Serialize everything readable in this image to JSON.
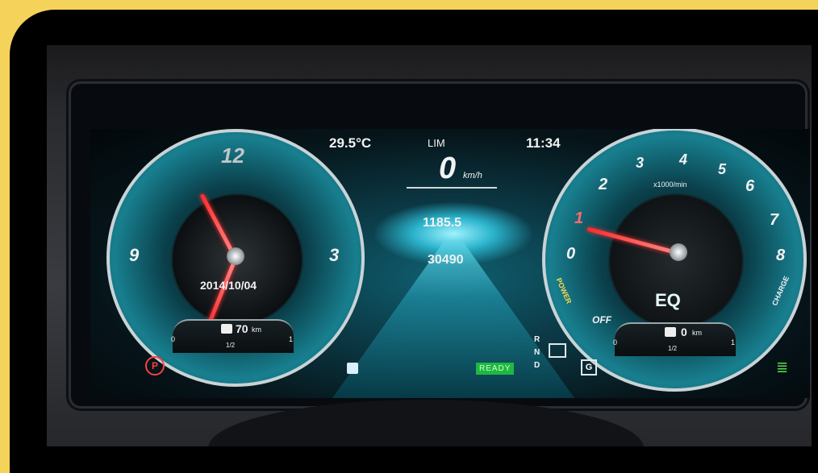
{
  "cluster": {
    "temperature": "29.5°C",
    "limiter": "LIM",
    "time": "11:34",
    "speed_value": "0",
    "speed_unit": "km/h",
    "trip": "1185.5",
    "odometer": "30490",
    "date": "2014/10/04",
    "left_range": "70",
    "left_range_unit": "km",
    "right_range": "0",
    "right_range_unit": "km",
    "gauge_half": "1/2",
    "gauge_zero": "0",
    "gauge_one": "1",
    "ready": "READY",
    "gear_r": "R",
    "gear_n": "N",
    "gear_d": "D",
    "gear_box": "G",
    "park_icon": "P",
    "eq": "EQ",
    "power_label": "POWER",
    "charge_label": "CHARGE",
    "off_label": "OFF",
    "rpm_unit": "x1000/min",
    "clock_numerals": [
      "12",
      "3",
      "9"
    ],
    "rpm_numerals": [
      "0",
      "1",
      "2",
      "3",
      "4",
      "5",
      "6",
      "7",
      "8"
    ]
  },
  "colors": {
    "accent": "#1fb840",
    "needle": "#ff2a2a",
    "frame": "#f5d25a"
  }
}
